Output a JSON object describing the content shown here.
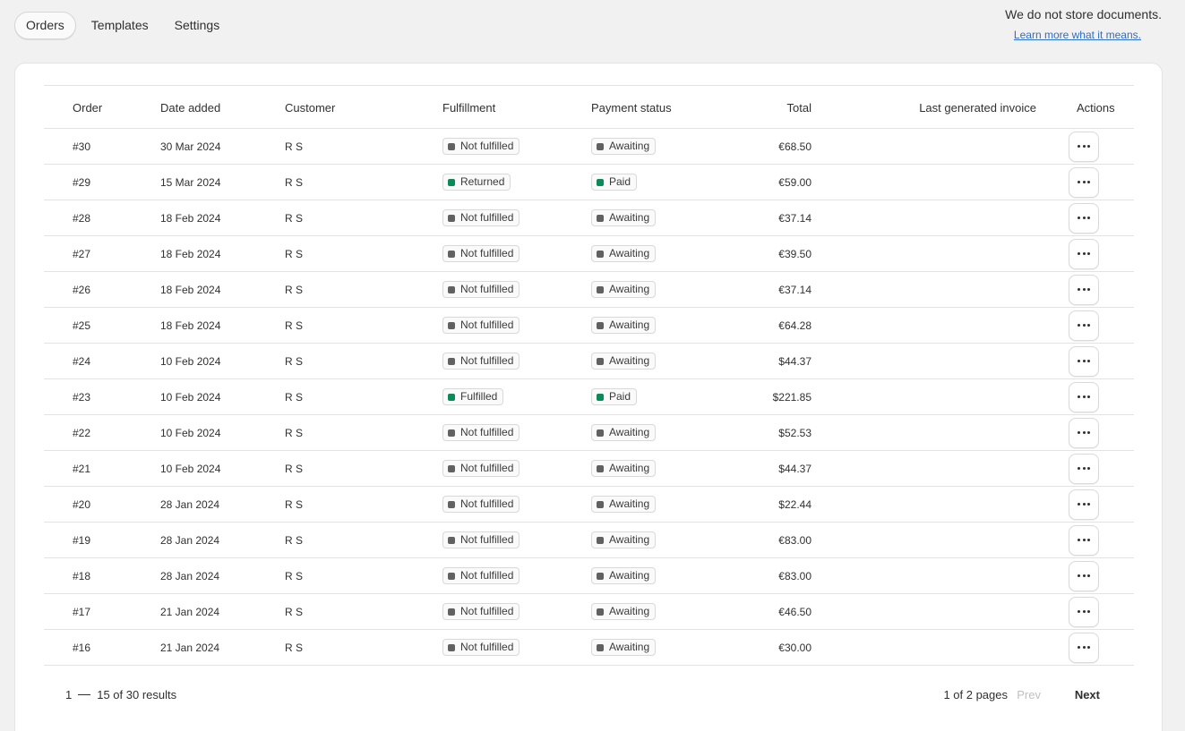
{
  "tabs": [
    {
      "label": "Orders",
      "active": true
    },
    {
      "label": "Templates",
      "active": false
    },
    {
      "label": "Settings",
      "active": false
    }
  ],
  "notice": {
    "text": "We do not store documents.",
    "link": "Learn more what it means."
  },
  "table": {
    "columns": [
      "Order",
      "Date added",
      "Customer",
      "Fulfillment",
      "Payment status",
      "Total",
      "Last generated invoice",
      "Actions"
    ],
    "rows": [
      {
        "order": "#30",
        "date": "30 Mar 2024",
        "customer": "R S",
        "fulfillment": "Not fulfilled",
        "payment": "Awaiting",
        "total": "€68.50",
        "invoice": ""
      },
      {
        "order": "#29",
        "date": "15 Mar 2024",
        "customer": "R S",
        "fulfillment": "Returned",
        "payment": "Paid",
        "total": "€59.00",
        "invoice": ""
      },
      {
        "order": "#28",
        "date": "18 Feb 2024",
        "customer": "R S",
        "fulfillment": "Not fulfilled",
        "payment": "Awaiting",
        "total": "€37.14",
        "invoice": ""
      },
      {
        "order": "#27",
        "date": "18 Feb 2024",
        "customer": "R S",
        "fulfillment": "Not fulfilled",
        "payment": "Awaiting",
        "total": "€39.50",
        "invoice": ""
      },
      {
        "order": "#26",
        "date": "18 Feb 2024",
        "customer": "R S",
        "fulfillment": "Not fulfilled",
        "payment": "Awaiting",
        "total": "€37.14",
        "invoice": ""
      },
      {
        "order": "#25",
        "date": "18 Feb 2024",
        "customer": "R S",
        "fulfillment": "Not fulfilled",
        "payment": "Awaiting",
        "total": "€64.28",
        "invoice": ""
      },
      {
        "order": "#24",
        "date": "10 Feb 2024",
        "customer": "R S",
        "fulfillment": "Not fulfilled",
        "payment": "Awaiting",
        "total": "$44.37",
        "invoice": ""
      },
      {
        "order": "#23",
        "date": "10 Feb 2024",
        "customer": "R S",
        "fulfillment": "Fulfilled",
        "payment": "Paid",
        "total": "$221.85",
        "invoice": ""
      },
      {
        "order": "#22",
        "date": "10 Feb 2024",
        "customer": "R S",
        "fulfillment": "Not fulfilled",
        "payment": "Awaiting",
        "total": "$52.53",
        "invoice": ""
      },
      {
        "order": "#21",
        "date": "10 Feb 2024",
        "customer": "R S",
        "fulfillment": "Not fulfilled",
        "payment": "Awaiting",
        "total": "$44.37",
        "invoice": ""
      },
      {
        "order": "#20",
        "date": "28 Jan 2024",
        "customer": "R S",
        "fulfillment": "Not fulfilled",
        "payment": "Awaiting",
        "total": "$22.44",
        "invoice": ""
      },
      {
        "order": "#19",
        "date": "28 Jan 2024",
        "customer": "R S",
        "fulfillment": "Not fulfilled",
        "payment": "Awaiting",
        "total": "€83.00",
        "invoice": ""
      },
      {
        "order": "#18",
        "date": "28 Jan 2024",
        "customer": "R S",
        "fulfillment": "Not fulfilled",
        "payment": "Awaiting",
        "total": "€83.00",
        "invoice": ""
      },
      {
        "order": "#17",
        "date": "21 Jan 2024",
        "customer": "R S",
        "fulfillment": "Not fulfilled",
        "payment": "Awaiting",
        "total": "€46.50",
        "invoice": ""
      },
      {
        "order": "#16",
        "date": "21 Jan 2024",
        "customer": "R S",
        "fulfillment": "Not fulfilled",
        "payment": "Awaiting",
        "total": "€30.00",
        "invoice": ""
      }
    ]
  },
  "pagination": {
    "range_start": "1",
    "range_rest": "15 of 30 results",
    "pages": "1 of 2 pages",
    "prev_label": "Prev",
    "next_label": "Next"
  },
  "colors": {
    "status_success": "#0a8a5b",
    "status_neutral": "#616161",
    "link": "#2c6ecb"
  },
  "icons": {
    "row_action": "more-horizontal-icon"
  }
}
